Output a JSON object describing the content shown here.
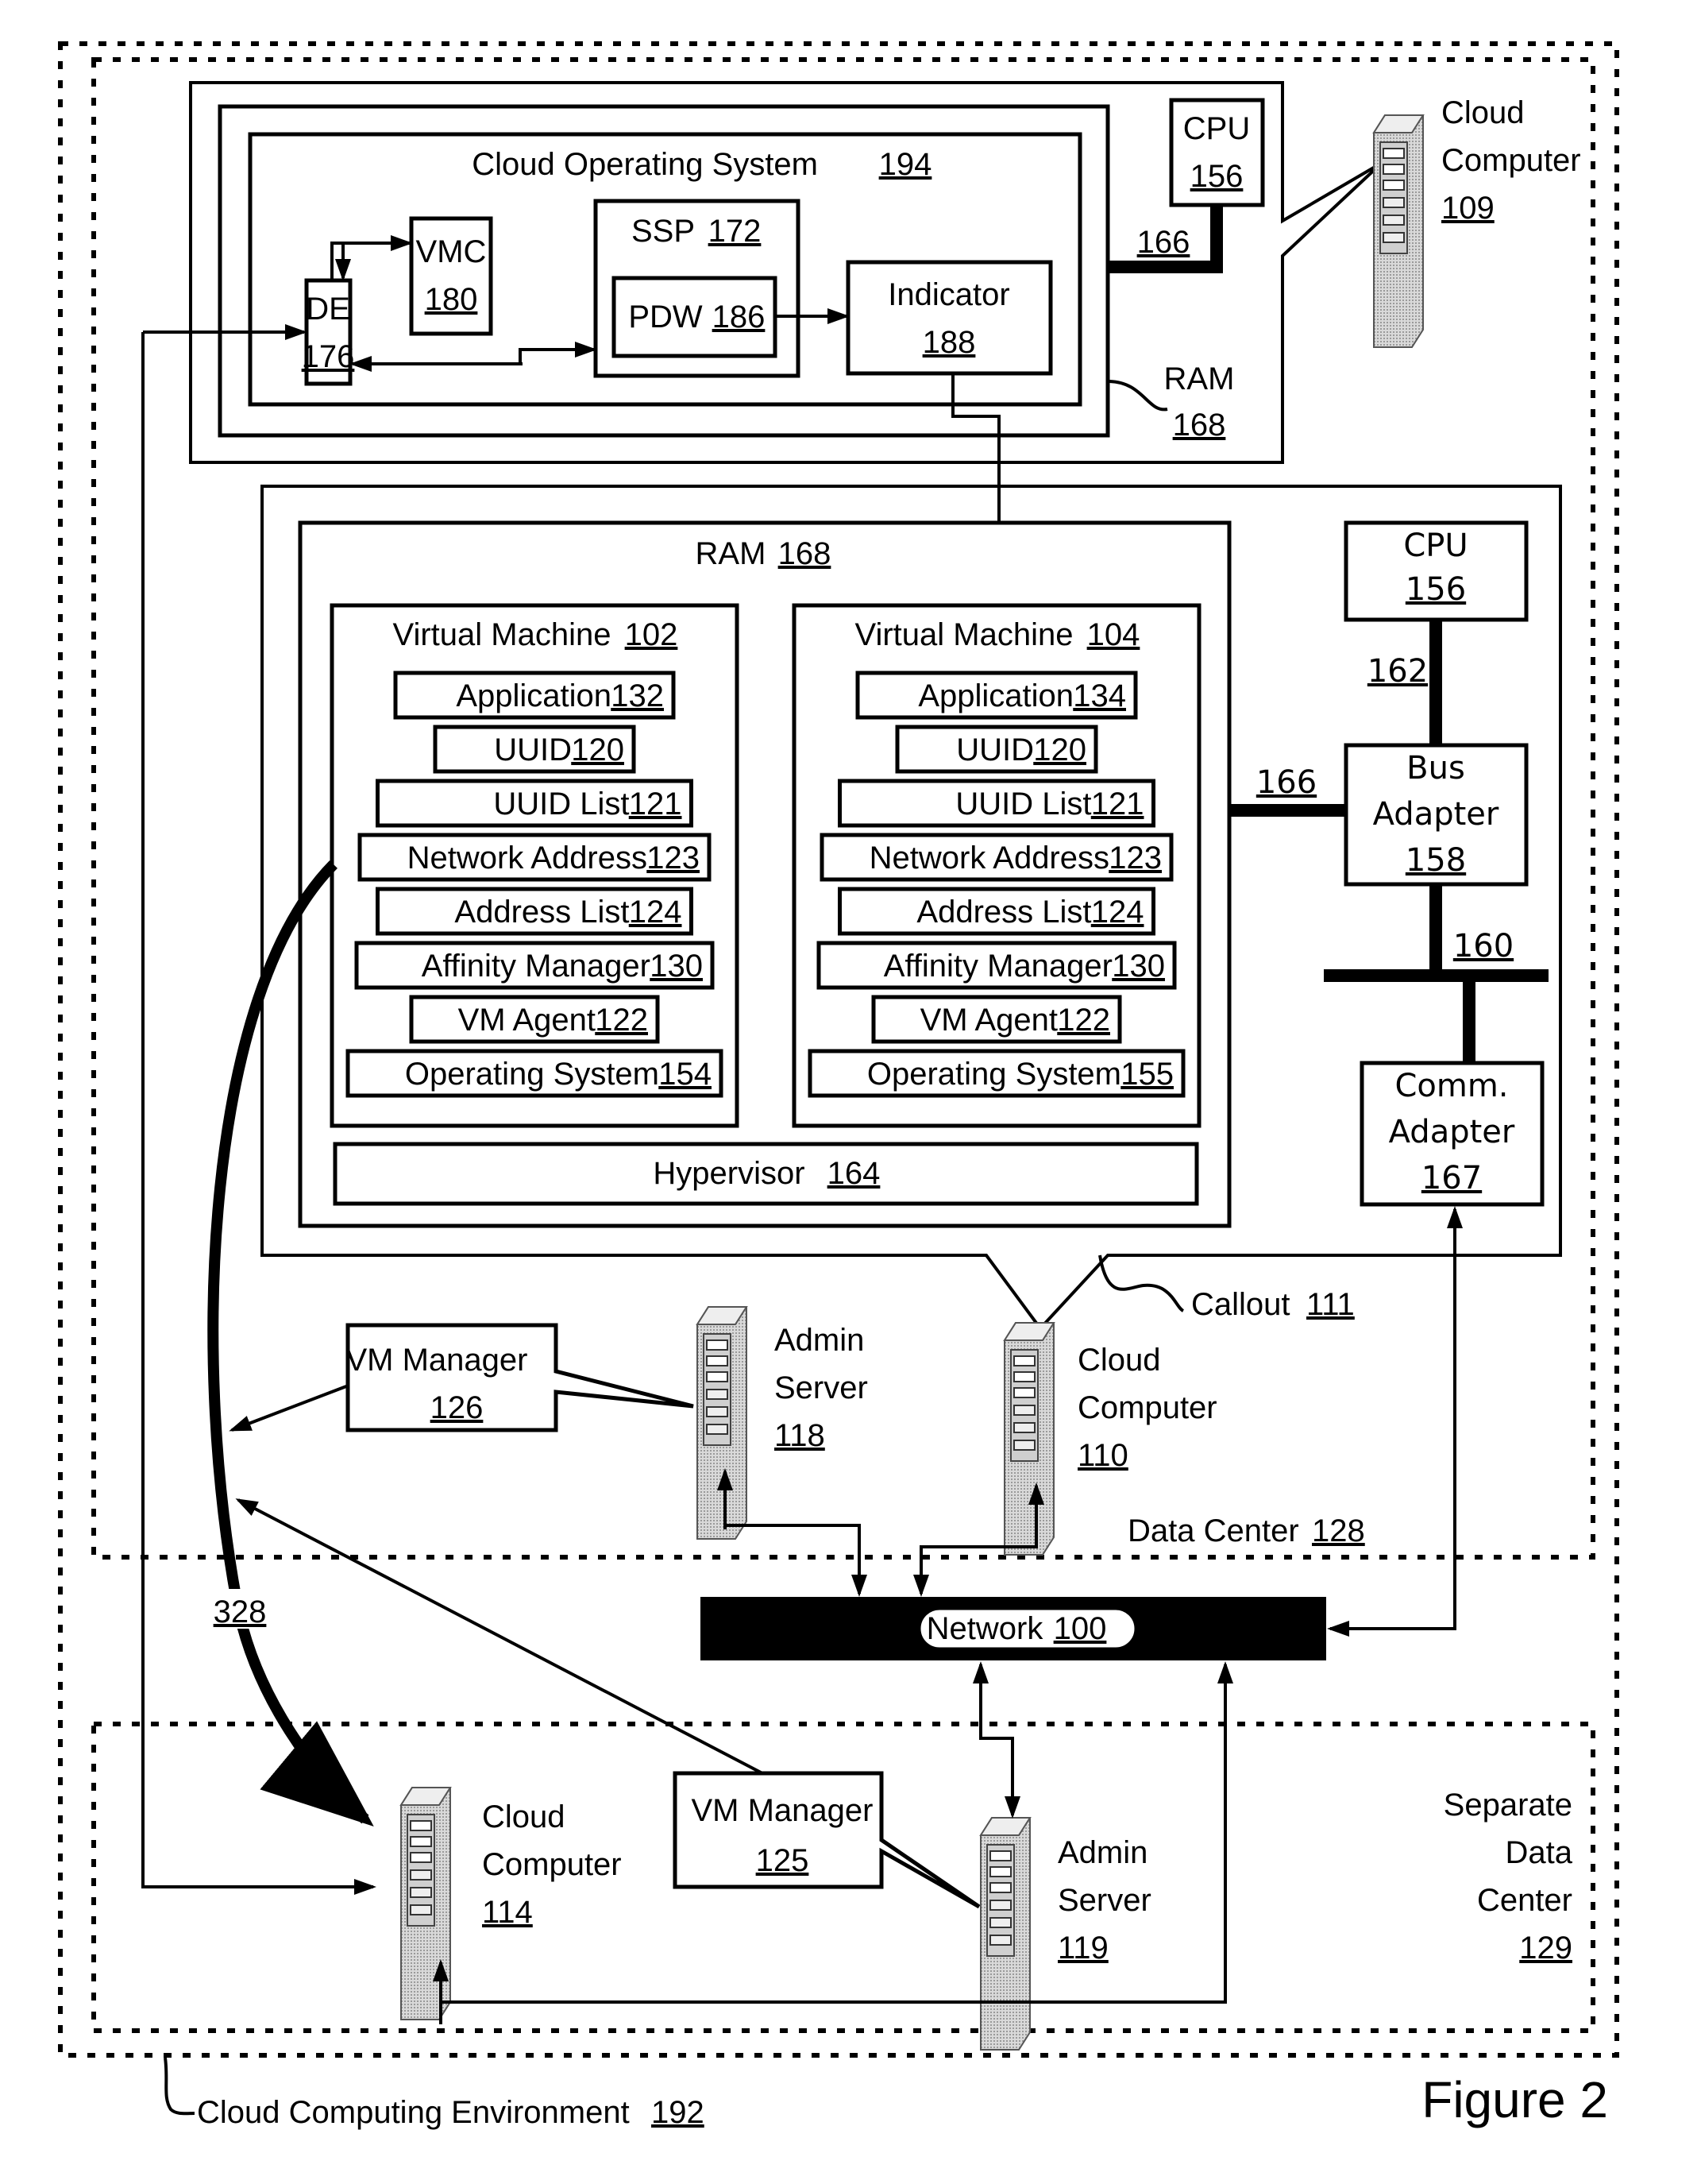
{
  "figure_label": "Figure  2",
  "environment": {
    "label": "Cloud Computing Environment",
    "num": "192"
  },
  "data_center": {
    "label": "Data Center",
    "num": "128"
  },
  "separate_dc": {
    "lines": [
      "Separate",
      "Data",
      "Center"
    ],
    "num": "129"
  },
  "top_computer": {
    "name_lines": [
      "Cloud",
      "Computer"
    ],
    "num": "109",
    "cpu": {
      "label": "CPU",
      "num": "156"
    },
    "bus_num": "166",
    "ram": {
      "label": "RAM",
      "num": "168"
    },
    "cloud_os": {
      "label": "Cloud Operating System",
      "num": "194"
    },
    "de": {
      "label": "DE",
      "num": "176"
    },
    "vmc": {
      "label": "VMC",
      "num": "180"
    },
    "ssp": {
      "label": "SSP",
      "num": "172"
    },
    "pdw": {
      "label": "PDW",
      "num": "186"
    },
    "indicator": {
      "label": "Indicator",
      "num": "188"
    }
  },
  "callout": {
    "label": "Callout",
    "num": "111",
    "ram": {
      "label": "RAM",
      "num": "168"
    },
    "vm1": {
      "title": "Virtual Machine",
      "num": "102",
      "items": [
        {
          "label": "Application",
          "num": "132"
        },
        {
          "label": "UUID",
          "num": "120"
        },
        {
          "label": "UUID List",
          "num": "121"
        },
        {
          "label": "Network Address",
          "num": "123"
        },
        {
          "label": "Address List",
          "num": "124"
        },
        {
          "label": "Affinity Manager",
          "num": "130"
        },
        {
          "label": "VM Agent",
          "num": "122"
        },
        {
          "label": "Operating System",
          "num": "154"
        }
      ]
    },
    "vm2": {
      "title": "Virtual Machine",
      "num": "104",
      "items": [
        {
          "label": "Application",
          "num": "134"
        },
        {
          "label": "UUID",
          "num": "120"
        },
        {
          "label": "UUID List",
          "num": "121"
        },
        {
          "label": "Network Address",
          "num": "123"
        },
        {
          "label": "Address List",
          "num": "124"
        },
        {
          "label": "Affinity Manager",
          "num": "130"
        },
        {
          "label": "VM Agent",
          "num": "122"
        },
        {
          "label": "Operating System",
          "num": "155"
        }
      ]
    },
    "hypervisor": {
      "label": "Hypervisor",
      "num": "164"
    },
    "cpu": {
      "label": "CPU",
      "num": "156"
    },
    "bus_162": "162",
    "bus_166": "166",
    "bus_160": "160",
    "bus_adapter": {
      "lines": [
        "Bus",
        "Adapter"
      ],
      "num": "158"
    },
    "comm_adapter": {
      "lines": [
        "Comm.",
        "Adapter"
      ],
      "num": "167"
    }
  },
  "vm_manager_126": {
    "label": "VM Manager",
    "num": "126"
  },
  "admin_server_118": {
    "lines": [
      "Admin",
      "Server"
    ],
    "num": "118"
  },
  "cloud_computer_110": {
    "lines": [
      "Cloud",
      "Computer"
    ],
    "num": "110"
  },
  "network": {
    "label": "Network",
    "num": "100"
  },
  "migration_path": {
    "num": "328"
  },
  "cloud_computer_114": {
    "lines": [
      "Cloud",
      "Computer"
    ],
    "num": "114"
  },
  "vm_manager_125": {
    "label": "VM Manager",
    "num": "125"
  },
  "admin_server_119": {
    "lines": [
      "Admin",
      "Server"
    ],
    "num": "119"
  }
}
